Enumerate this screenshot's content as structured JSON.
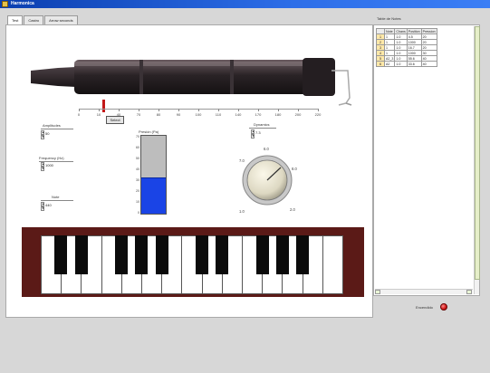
{
  "window": {
    "title": "Harmonica"
  },
  "tabs": [
    {
      "label": "Test",
      "active": true
    },
    {
      "label": "Castro",
      "active": false
    },
    {
      "label": "Arrow seconds",
      "active": false
    }
  ],
  "instrument": {
    "scale_ticks": [
      "0",
      "10",
      "40",
      "70",
      "80",
      "90",
      "100",
      "110",
      "140",
      "170",
      "180",
      "200",
      "220"
    ],
    "slider_label": "Select"
  },
  "controls": {
    "amplitude": {
      "label": "Amplitudes",
      "value": "50"
    },
    "frequency": {
      "label": "Frequency (Hz)",
      "value": "1000"
    },
    "note": {
      "label": "Note",
      "value": "440"
    },
    "pressure": {
      "label": "Presión (Pa)",
      "ticks": [
        "70",
        "60",
        "50",
        "40",
        "30",
        "20",
        "10",
        "0"
      ],
      "level_fraction": 0.46
    },
    "dynamics": {
      "label": "Dynamics",
      "value": "7.3",
      "dial_labels": [
        "6.0",
        "7.0",
        "8.0",
        "1.0",
        "2.0"
      ]
    }
  },
  "keyboard": {
    "white_keys": 15,
    "black_keys": 10
  },
  "right_panel": {
    "title": "Table de Notes",
    "columns": [
      "Note",
      "Chans",
      "Position",
      "Pression"
    ],
    "rows": [
      {
        "n": "1",
        "note": "1",
        "chans": "1.0",
        "position": "4.5",
        "pression": "20"
      },
      {
        "n": "2",
        "note": "1",
        "chans": "1.0",
        "position": "1000",
        "pression": "20"
      },
      {
        "n": "3",
        "note": "1",
        "chans": "1.0",
        "position": "16.7",
        "pression": "20"
      },
      {
        "n": "4",
        "note": "1",
        "chans": "1.0",
        "position": "1000",
        "pression": "30"
      },
      {
        "n": "5",
        "note": "A2_3",
        "chans": "1.0",
        "position": "55.6",
        "pression": "40"
      },
      {
        "n": "6",
        "note": "A2",
        "chans": "1.0",
        "position": "33.6",
        "pression": "40"
      }
    ]
  },
  "status": {
    "indicator_label": "Encendido",
    "indicator_color": "#d01515"
  }
}
